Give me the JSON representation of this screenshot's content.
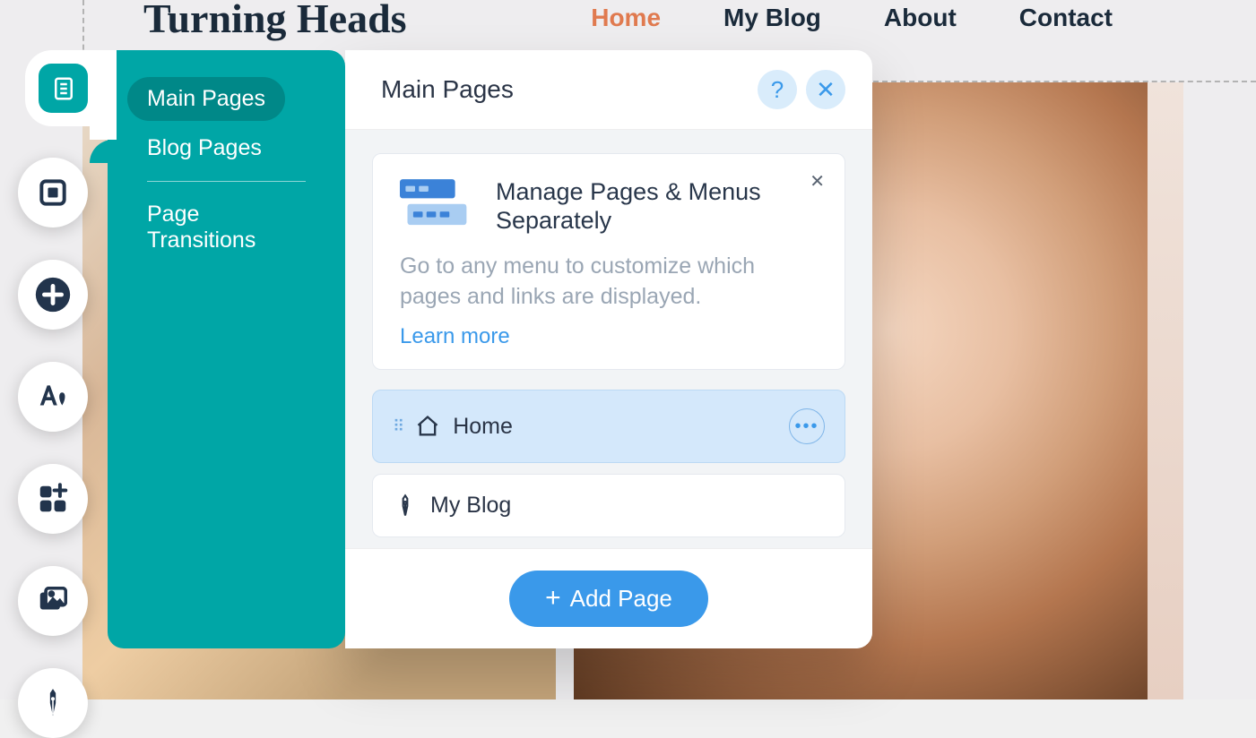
{
  "site": {
    "title": "Turning Heads",
    "nav": {
      "home": "Home",
      "blog": "My Blog",
      "about": "About",
      "contact": "Contact"
    }
  },
  "sidebar_categories": {
    "main_pages": "Main Pages",
    "blog_pages": "Blog Pages",
    "page_transitions": "Page Transitions"
  },
  "panel": {
    "title": "Main Pages",
    "info_card": {
      "title": "Manage Pages & Menus Separately",
      "description": "Go to any menu to customize which pages and links are displayed.",
      "learn_more": "Learn more"
    },
    "pages": [
      {
        "label": "Home",
        "icon": "home",
        "selected": true
      },
      {
        "label": "My Blog",
        "icon": "pen",
        "selected": false
      }
    ],
    "add_page": "Add Page"
  },
  "icons": {
    "help_glyph": "?",
    "close_glyph": "✕",
    "more_glyph": "•••",
    "drag_glyph": "⠿",
    "plus_glyph": "+"
  }
}
